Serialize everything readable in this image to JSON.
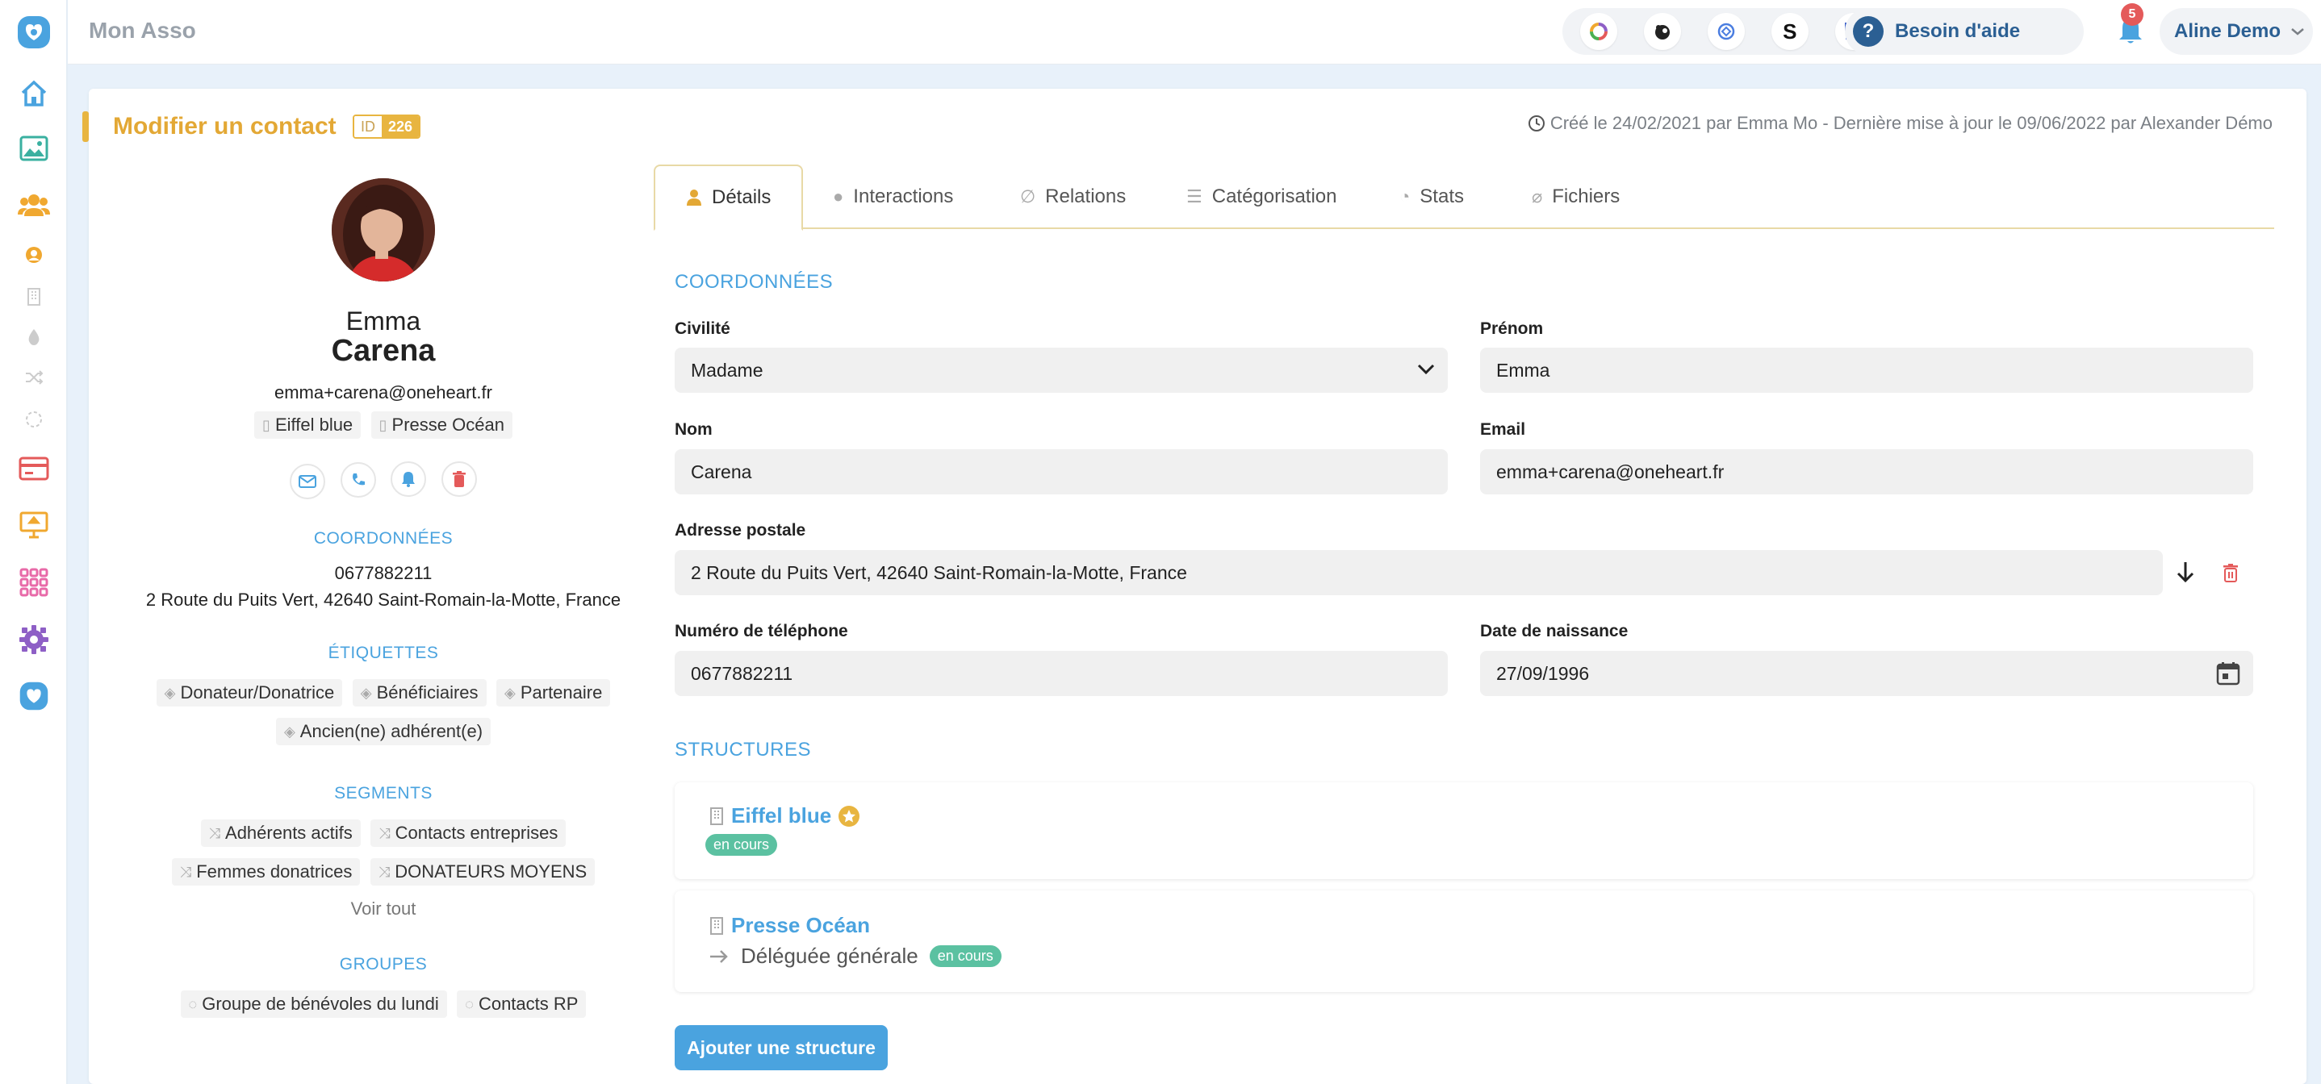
{
  "app": {
    "title": "Mon Asso"
  },
  "topbar": {
    "apps": [
      "colorful-ring-app-icon",
      "mailchimp-icon",
      "helloasso-icon",
      "s-app-icon",
      "qr-app-icon"
    ],
    "s_letter": "S",
    "help_label": "Besoin d'aide",
    "help_symbol": "?",
    "notification_count": "5",
    "user_name": "Aline Demo"
  },
  "page": {
    "title": "Modifier un contact",
    "id_label": "ID",
    "id_value": "226",
    "meta": "Créé le 24/02/2021 par Emma Mo - Dernière mise à jour le 09/06/2022 par Alexander Démo"
  },
  "profile": {
    "first_name": "Emma",
    "last_name": "Carena",
    "email": "emma+carena@oneheart.fr",
    "structures": [
      "Eiffel blue",
      "Presse Océan"
    ],
    "coordinates_heading": "COORDONNÉES",
    "phone": "0677882211",
    "address": "2 Route du Puits Vert, 42640 Saint-Romain-la-Motte, France",
    "tags_heading": "ÉTIQUETTES",
    "tags": [
      "Donateur/Donatrice",
      "Bénéficiaires",
      "Partenaire",
      "Ancien(ne) adhérent(e)"
    ],
    "segments_heading": "SEGMENTS",
    "segments": [
      "Adhérents actifs",
      "Contacts entreprises",
      "Femmes donatrices",
      "DONATEURS MOYENS"
    ],
    "see_all": "Voir tout",
    "groups_heading": "GROUPES",
    "groups": [
      "Groupe de bénévoles du lundi",
      "Contacts RP"
    ]
  },
  "tabs": [
    "Détails",
    "Interactions",
    "Relations",
    "Catégorisation",
    "Stats",
    "Fichiers"
  ],
  "form": {
    "section_coordinates": "COORDONNÉES",
    "civilite_label": "Civilité",
    "civilite_value": "Madame",
    "prenom_label": "Prénom",
    "prenom_value": "Emma",
    "nom_label": "Nom",
    "nom_value": "Carena",
    "email_label": "Email",
    "email_value": "emma+carena@oneheart.fr",
    "adresse_label": "Adresse postale",
    "adresse_value": "2 Route du Puits Vert, 42640 Saint-Romain-la-Motte, France",
    "tel_label": "Numéro de téléphone",
    "tel_value": "0677882211",
    "naissance_label": "Date de naissance",
    "naissance_value": "27/09/1996",
    "section_structures": "STRUCTURES",
    "structures": [
      {
        "name": "Eiffel blue",
        "status": "en cours",
        "role": ""
      },
      {
        "name": "Presse Océan",
        "status": "en cours",
        "role": "Déléguée générale"
      }
    ],
    "add_structure": "Ajouter une structure"
  },
  "colors": {
    "accent": "#e3a835",
    "primary": "#4aa3df",
    "status": "#5bc1a1",
    "danger": "#e45a5a"
  }
}
